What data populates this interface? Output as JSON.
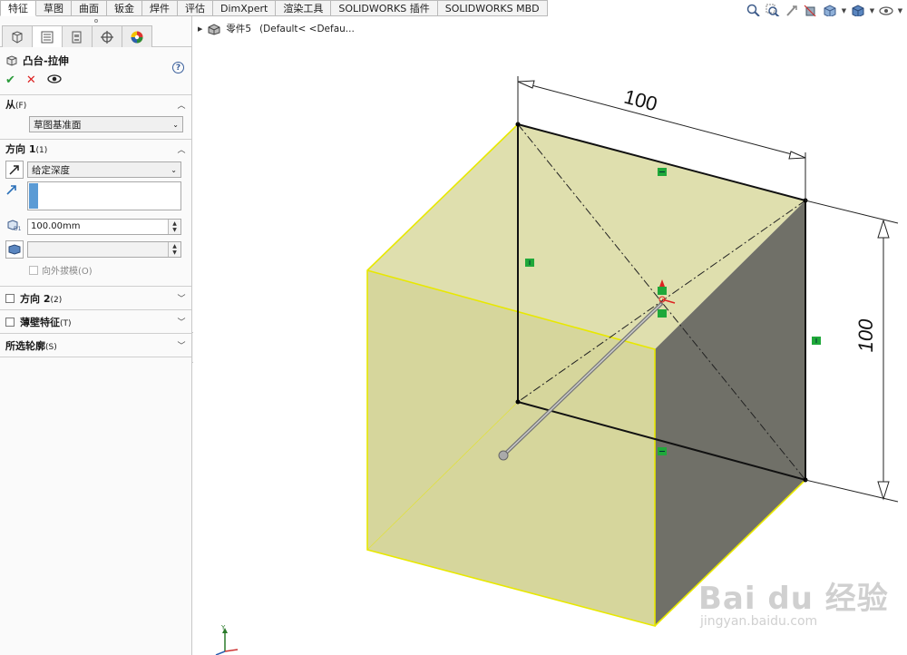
{
  "tabs": [
    "特征",
    "草图",
    "曲面",
    "钣金",
    "焊件",
    "评估",
    "DimXpert",
    "渲染工具",
    "SOLIDWORKS 插件",
    "SOLIDWORKS MBD"
  ],
  "view_toolbar": [
    "zoom-to-fit-icon",
    "zoom-area-icon",
    "previous-view-icon",
    "section-view-icon",
    "view-orientation-icon",
    "display-style-icon",
    "hide-show-icon",
    "appearance-icon"
  ],
  "feature": {
    "title": "凸台-拉伸",
    "help": "?"
  },
  "from": {
    "label": "从",
    "hotkey": "(F)",
    "value": "草图基准面"
  },
  "direction1": {
    "label": "方向 1",
    "hotkey": "(1)",
    "end_condition": "给定深度",
    "depth": "100.00mm",
    "draft_label": "向外拔模(O)"
  },
  "direction2": {
    "label": "方向 2",
    "hotkey": "(2)"
  },
  "thin": {
    "label": "薄壁特征",
    "hotkey": "(T)"
  },
  "contours": {
    "label": "所选轮廓",
    "hotkey": "(S)"
  },
  "tree": {
    "name": "零件5",
    "config": "(Default< <Defau..."
  },
  "dimensions": {
    "top": "100",
    "right": "100"
  },
  "watermark": {
    "logo": "Bai du 经验",
    "url": "jingyan.baidu.com"
  },
  "colors": {
    "face_yellow": "#d9d9a0",
    "edge_yellow": "#e8e800",
    "dark_face": "#707068",
    "selection_blue": "#5b9bd5"
  }
}
